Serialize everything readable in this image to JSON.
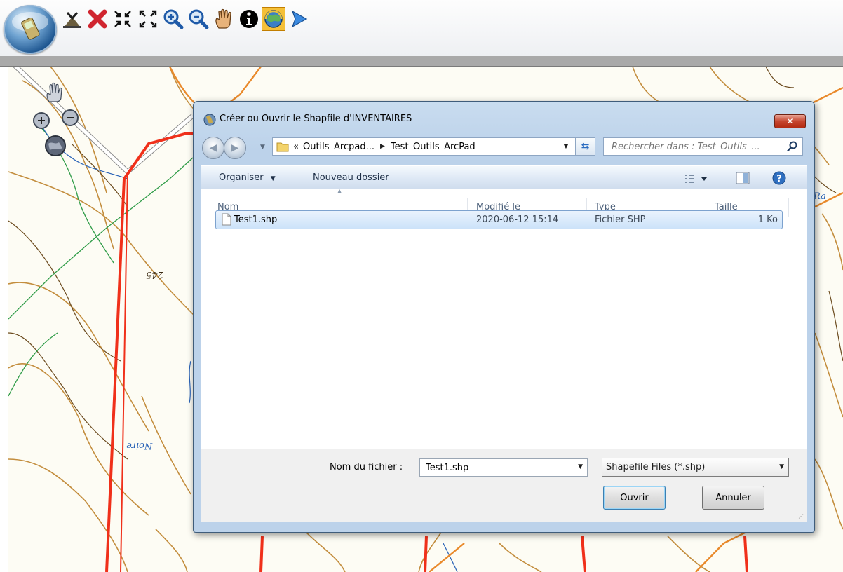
{
  "toolbar": {
    "tools": [
      {
        "icon": "app-orb-icon"
      },
      {
        "icon": "map-layers-icon"
      },
      {
        "icon": "delete-x-icon"
      },
      {
        "icon": "zoom-in-arrows-icon"
      },
      {
        "icon": "zoom-out-arrows-icon"
      },
      {
        "icon": "zoom-in-icon"
      },
      {
        "icon": "zoom-out-icon"
      },
      {
        "icon": "pan-hand-icon"
      },
      {
        "icon": "info-icon"
      },
      {
        "icon": "find-globe-icon",
        "active": true
      },
      {
        "icon": "pointer-arrow-icon"
      }
    ],
    "active_color": "#f5c038"
  },
  "map": {
    "labels": {
      "elevation": "245",
      "place": "Noire",
      "partial_right": "Ra"
    },
    "colors": {
      "boundary": "#f0301a",
      "contour": "#c38d3d",
      "stream": "#2f9c48",
      "road": "#e98a2c",
      "background": "#fdfcf4"
    }
  },
  "dialog": {
    "title": "Créer ou Ouvrir le Shapfile d'INVENTAIRES",
    "close_label": "✕",
    "breadcrumb": {
      "prefix": "«",
      "items": [
        "Outils_Arcpad...",
        "Test_Outils_ArcPad"
      ]
    },
    "search_placeholder": "Rechercher dans : Test_Outils_...",
    "commands": {
      "organize": "Organiser",
      "new_folder": "Nouveau dossier"
    },
    "columns": [
      "Nom",
      "Modifié le",
      "Type",
      "Taille"
    ],
    "files": [
      {
        "name": "Test1.shp",
        "modified": "2020-06-12 15:14",
        "type": "Fichier SHP",
        "size": "1 Ko"
      }
    ],
    "filename_label": "Nom du fichier :",
    "filename_value": "Test1.shp",
    "filetype_value": "Shapefile Files (*.shp)",
    "open_label": "Ouvrir",
    "cancel_label": "Annuler"
  }
}
